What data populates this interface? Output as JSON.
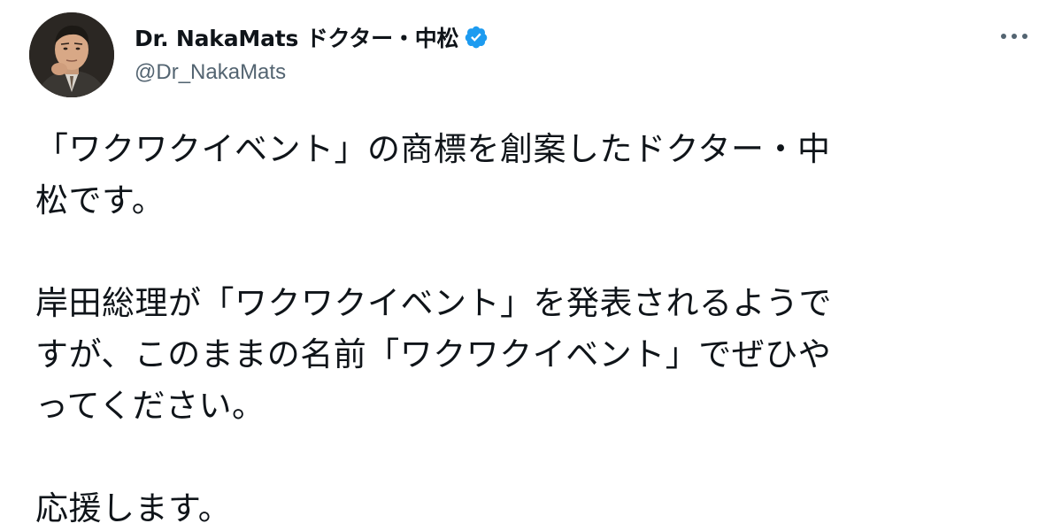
{
  "author": {
    "display_name": "Dr. NakaMats ドクター・中松",
    "handle": "@Dr_NakaMats",
    "verified": true
  },
  "tweet": {
    "lines": [
      "「ワクワクイベント」の商標を創案したドクター・中",
      "松です。",
      "岸田総理が「ワクワクイベント」を発表されるようで",
      "すが、このままの名前「ワクワクイベント」でぜひや",
      "ってください。",
      "応援します。"
    ]
  },
  "icons": {
    "verified_badge": "verified-badge-icon",
    "more": "more-options-icon"
  },
  "colors": {
    "text": "#0f1419",
    "secondary_text": "#536471",
    "verified_blue": "#1d9bf0"
  }
}
